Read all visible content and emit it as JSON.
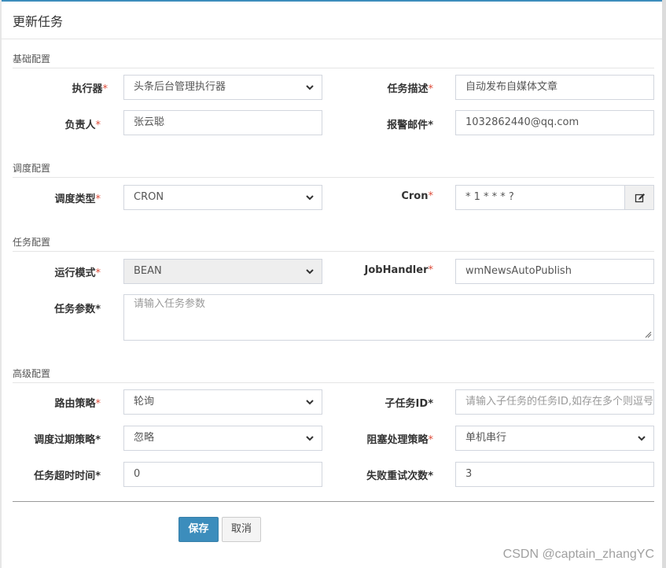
{
  "dialog": {
    "title": "更新任务"
  },
  "sections": {
    "basic": "基础配置",
    "schedule": "调度配置",
    "task": "任务配置",
    "advanced": "高级配置"
  },
  "fields": {
    "executor": {
      "label": "执行器",
      "value": "头条后台管理执行器"
    },
    "job_desc": {
      "label": "任务描述",
      "value": "自动发布自媒体文章"
    },
    "author": {
      "label": "负责人",
      "value": "张云聪"
    },
    "alarm_email": {
      "label": "报警邮件",
      "value": "1032862440@qq.com"
    },
    "schedule_type": {
      "label": "调度类型",
      "value": "CRON"
    },
    "cron": {
      "label": "Cron",
      "value": "* 1 * * * ?"
    },
    "run_mode": {
      "label": "运行模式",
      "value": "BEAN"
    },
    "job_handler": {
      "label": "JobHandler",
      "value": "wmNewsAutoPublish"
    },
    "job_param": {
      "label": "任务参数",
      "placeholder": "请输入任务参数"
    },
    "route_strategy": {
      "label": "路由策略",
      "value": "轮询"
    },
    "child_job_id": {
      "label": "子任务ID",
      "placeholder": "请输入子任务的任务ID,如存在多个则逗号分隔"
    },
    "misfire_strategy": {
      "label": "调度过期策略",
      "value": "忽略"
    },
    "block_strategy": {
      "label": "阻塞处理策略",
      "value": "单机串行"
    },
    "timeout": {
      "label": "任务超时时间",
      "value": "0"
    },
    "fail_retry": {
      "label": "失败重试次数",
      "value": "3"
    }
  },
  "required_mark": "*",
  "buttons": {
    "save": "保存",
    "cancel": "取消"
  },
  "watermark": "CSDN @captain_zhangYC",
  "colors": {
    "primary": "#3c8dbc",
    "required": "#dd4b39"
  },
  "icons": {
    "cron_editor": "edit-icon",
    "select": "chevron-down-icon"
  }
}
